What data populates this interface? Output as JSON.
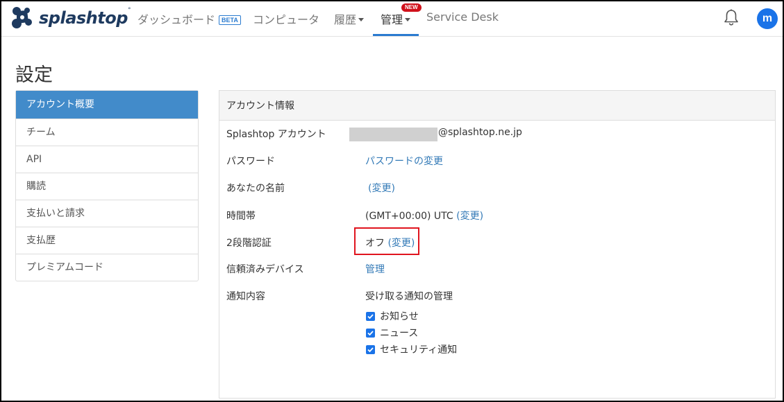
{
  "header": {
    "brand": "splashtop",
    "nav": {
      "dashboard": "ダッシュボード",
      "beta_badge": "BETA",
      "computers": "コンピュータ",
      "history": "履歴",
      "management": "管理",
      "new_badge": "NEW",
      "service_desk": "Service Desk"
    },
    "avatar_initial": "m"
  },
  "page": {
    "title": "設定"
  },
  "sidebar": {
    "items": [
      {
        "label": "アカウント概要",
        "active": true
      },
      {
        "label": "チーム"
      },
      {
        "label": "API"
      },
      {
        "label": "購読"
      },
      {
        "label": "支払いと請求"
      },
      {
        "label": "支払歴"
      },
      {
        "label": "プレミアムコード"
      }
    ]
  },
  "account": {
    "heading": "アカウント情報",
    "rows": {
      "splashtop_account": {
        "label": "Splashtop アカウント",
        "value": "@splashtop.ne.jp"
      },
      "password": {
        "label": "パスワード",
        "link": "パスワードの変更"
      },
      "name": {
        "label": "あなたの名前",
        "link": "(変更)"
      },
      "timezone": {
        "label": "時間帯",
        "value": "(GMT+00:00) UTC",
        "link": "(変更)"
      },
      "two_factor": {
        "label": "2段階認証",
        "value": "オフ",
        "link": "(変更)"
      },
      "trusted_devices": {
        "label": "信頼済みデバイス",
        "link": "管理"
      },
      "notifications": {
        "label": "通知内容",
        "title": "受け取る通知の管理",
        "options": [
          {
            "label": "お知らせ",
            "checked": true
          },
          {
            "label": "ニュース",
            "checked": true
          },
          {
            "label": "セキュリティ通知",
            "checked": true
          }
        ]
      }
    }
  },
  "colors": {
    "accent": "#428bca",
    "link": "#337ab7",
    "highlight": "#e0141e",
    "avatar": "#1a73e8"
  }
}
